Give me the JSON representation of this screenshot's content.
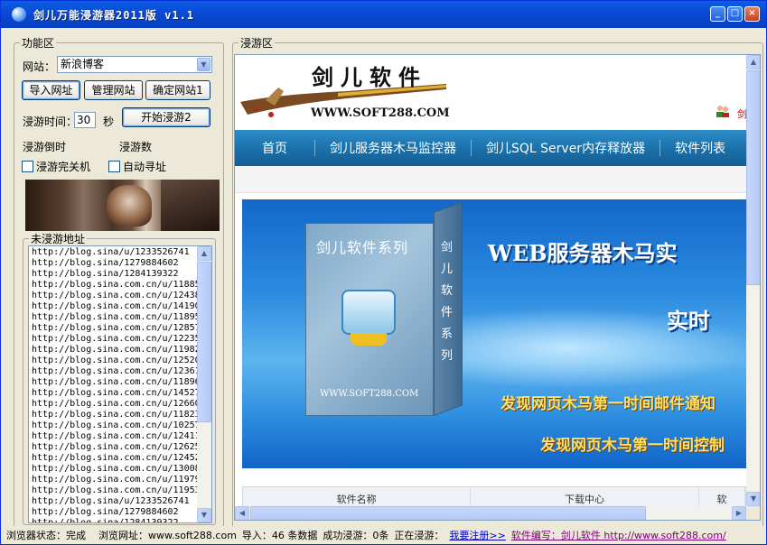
{
  "window": {
    "title": "剑儿万能浸游器2011版 v1.1"
  },
  "func_panel": {
    "legend": "功能区",
    "site_label": "网站：",
    "site_value": "新浪博客",
    "import_btn": "导入网址",
    "manage_btn": "管理网站",
    "confirm_btn": "确定网站1",
    "time_label": "浸游时间：",
    "time_value": "30",
    "time_unit": "秒",
    "start_btn": "开始浸游2",
    "countdown_label": "浸游倒时",
    "count_label": "浸游数",
    "shutdown_chk": "浸游完关机",
    "autofind_chk": "自动寻址",
    "url_legend": "未浸游地址",
    "urls": [
      "http://blog.sina/u/1233526741",
      "http://blog.sina/1279884602",
      "http://blog.sina/1284139322",
      "http://blog.sina.com.cn/u/11885",
      "http://blog.sina.com.cn/u/12438",
      "http://blog.sina.com.cn/u/14190",
      "http://blog.sina.com.cn/u/11895",
      "http://blog.sina.com.cn/u/12857",
      "http://blog.sina.com.cn/u/12235",
      "http://blog.sina.com.cn/u/11982",
      "http://blog.sina.com.cn/u/12520",
      "http://blog.sina.com.cn/u/12361",
      "http://blog.sina.com.cn/u/11896",
      "http://blog.sina.com.cn/u/14527",
      "http://blog.sina.com.cn/u/12660",
      "http://blog.sina.com.cn/u/11823",
      "http://blog.sina.com.cn/u/10257",
      "http://blog.sina.com.cn/u/12411",
      "http://blog.sina.com.cn/u/12625",
      "http://blog.sina.com.cn/u/12452",
      "http://blog.sina.com.cn/u/13008",
      "http://blog.sina.com.cn/u/11979",
      "http://blog.sina.com.cn/u/11953",
      "http://blog.sina/u/1233526741",
      "http://blog.sina/1279884602",
      "http://blog.sina/1284139322"
    ]
  },
  "browse_panel": {
    "legend": "浸游区",
    "logo_cn": "剑儿软件",
    "logo_url": "WWW.SOFT288.COM",
    "user_text": "剑",
    "nav": [
      "首页",
      "剑儿服务器木马监控器",
      "剑儿SQL Server内存释放器",
      "软件列表"
    ],
    "box_title": "剑儿软件系列",
    "box_side": "剑儿软件系列",
    "box_url": "WWW.SOFT288.COM",
    "promo_h1": "WEB服务器木马实",
    "promo_h2": "实时",
    "promo_l1": "发现网页木马第一时间邮件通知",
    "promo_l2": "发现网页木马第一时间控制",
    "table_cols": [
      "软件名称",
      "下载中心",
      "软"
    ]
  },
  "status": {
    "state": "浏览器状态：完成",
    "url": "浏览网址：www.soft288.com",
    "imported": "导入：46 条数据",
    "success": "成功浸游：0条",
    "current": "正在浸游：",
    "register": "我要注册>>",
    "author": "软件编写：剑儿软件 http://www.soft288.com/"
  },
  "colors": {
    "titlebar": "#0a4bd8",
    "nav": "#1a6fa8",
    "promo": "#2b8be0"
  }
}
